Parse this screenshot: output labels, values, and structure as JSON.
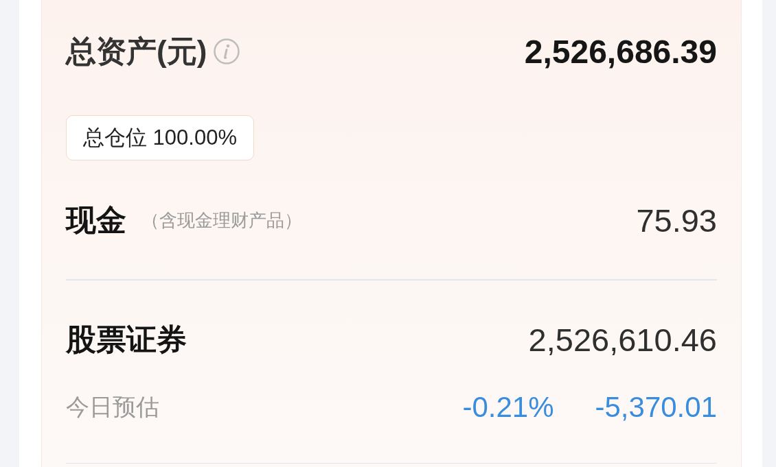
{
  "summary": {
    "title": "总资产(元)",
    "value": "2,526,686.39"
  },
  "position": {
    "label": "总仓位 100.00%"
  },
  "holdings": [
    {
      "name": "现金",
      "note": "（含现金理财产品）",
      "value": "75.93"
    },
    {
      "name": "股票证券",
      "value": "2,526,610.46",
      "estimate": {
        "label": "今日预估",
        "down": true,
        "percent": "-0.21%",
        "amount": "-5,370.01"
      }
    }
  ]
}
